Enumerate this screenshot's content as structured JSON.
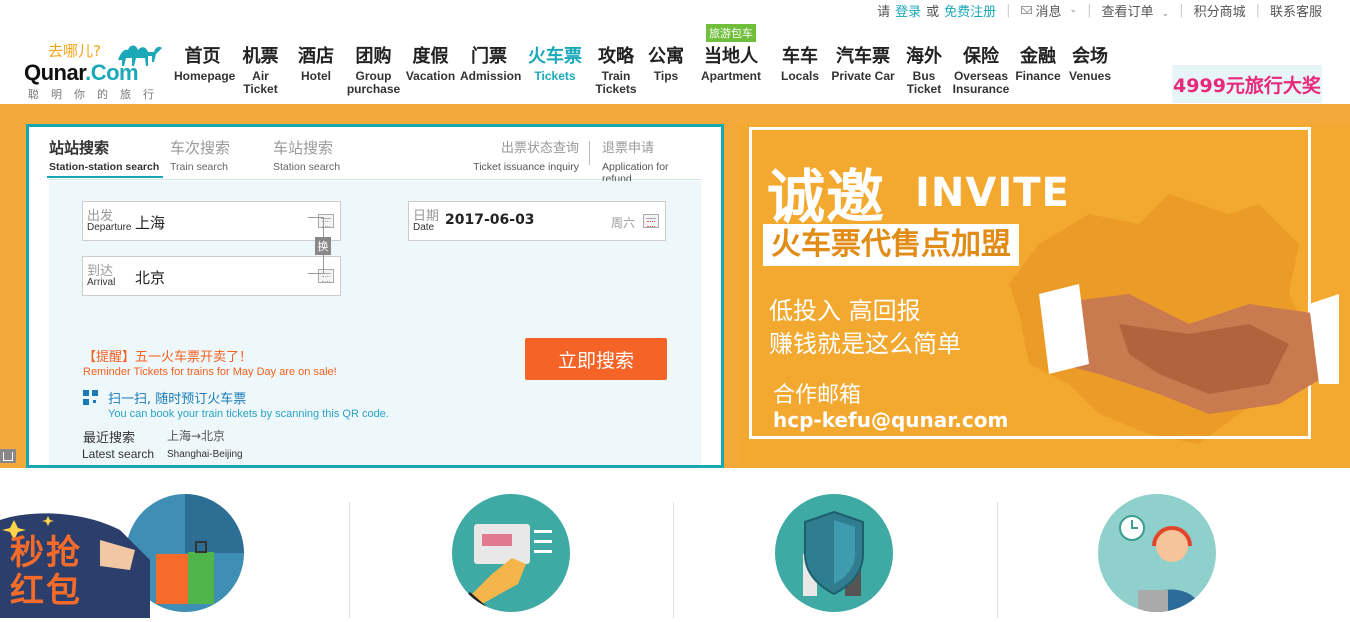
{
  "topbar": {
    "please": "请",
    "login": "登录",
    "or": "或",
    "register": "免费注册",
    "messages": "消息",
    "orders": "查看订单",
    "points_mall": "积分商城",
    "contact": "联系客服"
  },
  "logo": {
    "slogan_top": "去哪儿?",
    "brand_a": "Qunar",
    "brand_b": ".Com",
    "slogan": "聪明你的旅行"
  },
  "nav": [
    {
      "zh": "首页",
      "en": "Homepage"
    },
    {
      "zh": "机票",
      "en": "Air Ticket"
    },
    {
      "zh": "酒店",
      "en": "Hotel"
    },
    {
      "zh": "团购",
      "en": "Group purchase"
    },
    {
      "zh": "度假",
      "en": "Vacation"
    },
    {
      "zh": "门票",
      "en": "Admission"
    },
    {
      "zh": "火车票",
      "en": "Tickets",
      "active": true
    },
    {
      "zh": "攻略",
      "en": "Train Tickets"
    },
    {
      "zh": "公寓",
      "en": "Tips"
    },
    {
      "zh": "当地人",
      "en": "Apartment",
      "badge": "旅游包车"
    },
    {
      "zh": "车车",
      "en": "Locals"
    },
    {
      "zh": "汽车票",
      "en": "Private Car"
    },
    {
      "zh": "海外",
      "en": "Bus Ticket"
    },
    {
      "zh": "保险",
      "en": "Overseas Insurance"
    },
    {
      "zh": "金融",
      "en": "Finance"
    },
    {
      "zh": "会场",
      "en": "Venues"
    }
  ],
  "promo": "4999元旅行大奖",
  "search": {
    "tabs": [
      {
        "zh": "站站搜索",
        "en": "Station-station search"
      },
      {
        "zh": "车次搜索",
        "en": "Train search"
      },
      {
        "zh": "车站搜索",
        "en": "Station search"
      }
    ],
    "side_tabs": [
      {
        "zh": "出票状态查询",
        "en": "Ticket issuance inquiry"
      },
      {
        "zh": "退票申请",
        "en": "Application for refund"
      }
    ],
    "departure_zh": "出发",
    "departure_en": "Departure",
    "departure_value": "上海",
    "arrival_zh": "到达",
    "arrival_en": "Arrival",
    "arrival_value": "北京",
    "date_zh": "日期",
    "date_en": "Date",
    "date_value": "2017-06-03",
    "weekday": "周六",
    "swap": "换",
    "reminder_zh": "【提醒】五一火车票开卖了！",
    "reminder_en": "Reminder  Tickets for trains for May Day are on sale!",
    "search_button": "立即搜索",
    "qr_zh": "扫一扫, 随时预订火车票",
    "qr_en": "You can book your train tickets by scanning this QR code.",
    "recent_zh": "最近搜索",
    "recent_value": "上海→北京",
    "recent_en": "Latest search",
    "recent_value_en": "Shanghai-Beijing"
  },
  "banner": {
    "title": "诚邀",
    "invite": "INVITE",
    "join": "火车票代售点加盟",
    "line1": "低投入 高回报",
    "line2": "赚钱就是这么简单",
    "contact": "合作邮箱",
    "email": "hcp-kefu@qunar.com"
  },
  "redpack": "秒抢红包",
  "colors": {
    "accent": "#1ba9ba",
    "hero_bg": "#f4aa3a",
    "search_button": "#f56326",
    "promo_text": "#e8287a"
  }
}
